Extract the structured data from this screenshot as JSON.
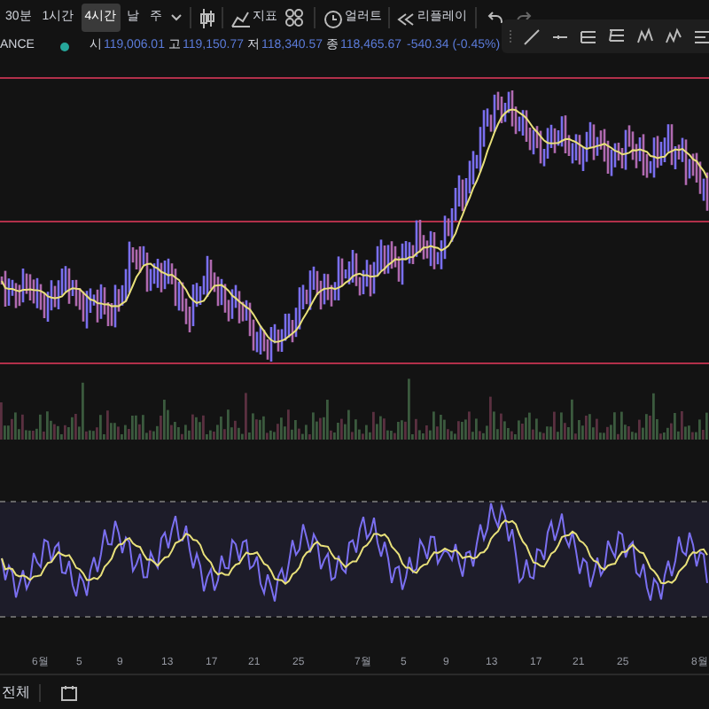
{
  "toolbar": {
    "intervals": [
      {
        "label": "30분",
        "selected": false
      },
      {
        "label": "1시간",
        "selected": false
      },
      {
        "label": "4시간",
        "selected": true
      },
      {
        "label": "날",
        "selected": false
      },
      {
        "label": "주",
        "selected": false
      }
    ],
    "buttons": [
      {
        "kind": "indicators",
        "label": "지표"
      },
      {
        "kind": "alert",
        "label": "얼러트"
      },
      {
        "kind": "replay",
        "label": "리플레이"
      }
    ]
  },
  "symbol_bar": {
    "symbol": "ANCE",
    "open_label": "시",
    "open": "119,006.01",
    "high_label": "고",
    "high": "119,150.77",
    "low_label": "저",
    "low": "118,340.57",
    "close_label": "종",
    "close": "118,465.67",
    "change": "-540.34 (-0.45%)"
  },
  "x_axis": {
    "ticks": [
      "6월",
      "5",
      "9",
      "13",
      "17",
      "21",
      "25",
      "7월",
      "5",
      "9",
      "13",
      "17",
      "21",
      "25",
      "8월"
    ]
  },
  "bottom_bar": {
    "range": "전체"
  }
}
